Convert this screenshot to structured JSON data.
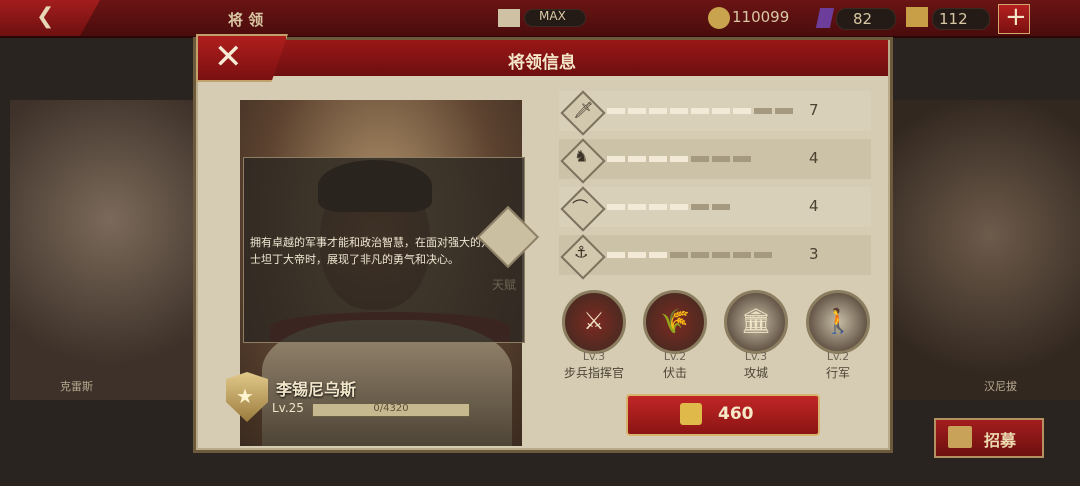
{
  "topbar": {
    "back_icon": "back-arrow-icon",
    "title": "将 领",
    "castle_label": "MAX",
    "coins": "110099",
    "gems": "82",
    "scrolls": "112",
    "plus_label": "+"
  },
  "background": {
    "left_general_name": "克雷斯",
    "right_general_name": "汉尼拔"
  },
  "panel": {
    "title": "将领信息",
    "close_label": "✕"
  },
  "general": {
    "description": "拥有卓越的军事才能和政治智慧，在面对强大的对手君士坦丁大帝时，展现了非凡的勇气和决心。",
    "talent_label": "天赋",
    "name": "李锡尼乌斯",
    "level": "Lv.25",
    "xp": "0/4320",
    "rank_star": "★"
  },
  "stats": [
    {
      "icon": "sword-icon",
      "glyph": "🗡",
      "value": 7,
      "max": 9,
      "fill_color": "#f2ead6"
    },
    {
      "icon": "horse-icon",
      "glyph": "♞",
      "value": 4,
      "max": 7,
      "fill_color": "#f2ead6"
    },
    {
      "icon": "bow-icon",
      "glyph": "⌒",
      "value": 4,
      "max": 6,
      "fill_color": "#f2ead6"
    },
    {
      "icon": "anchor-icon",
      "glyph": "⚓",
      "value": 3,
      "max": 8,
      "fill_color": "#f2ead6"
    }
  ],
  "skills": [
    {
      "icon": "crossed-swords-icon",
      "glyph": "⚔",
      "level": "Lv.3",
      "name": "步兵指挥官",
      "color": "#7d2a22"
    },
    {
      "icon": "ambush-icon",
      "glyph": "🌾",
      "level": "Lv.2",
      "name": "伏击",
      "color": "#7d2a22"
    },
    {
      "icon": "siege-icon",
      "glyph": "🏛",
      "level": "Lv.3",
      "name": "攻城",
      "color": "#c8bfa6"
    },
    {
      "icon": "march-icon",
      "glyph": "🚶",
      "level": "Lv.2",
      "name": "行军",
      "color": "#c8bfa6"
    }
  ],
  "recruit": {
    "cost": "460",
    "cost_icon": "scroll-icon",
    "button_label": "招募"
  }
}
